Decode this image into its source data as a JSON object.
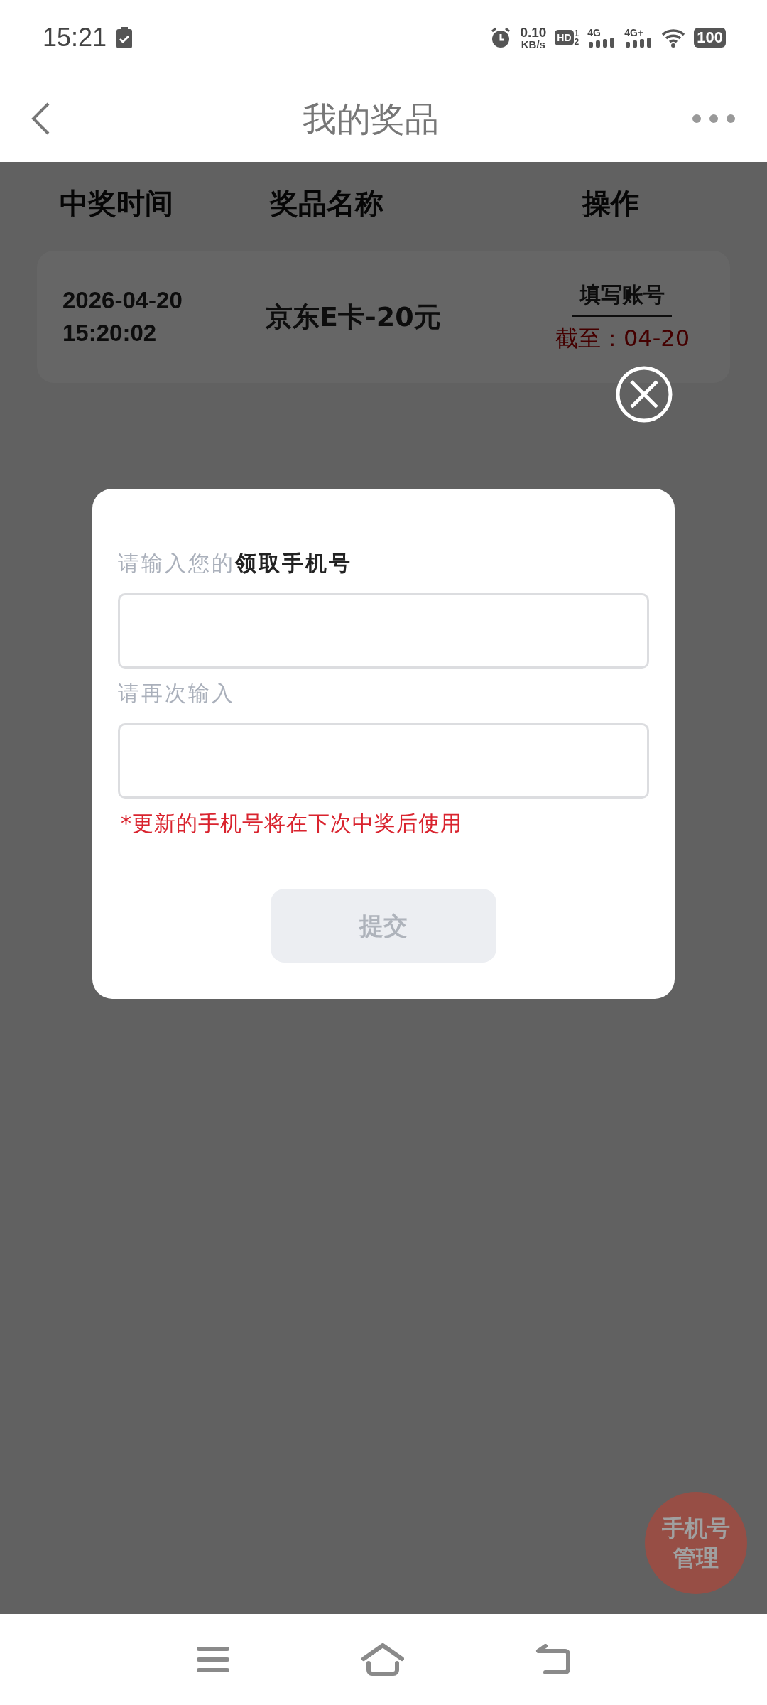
{
  "status_bar": {
    "time": "15:21",
    "speed_value": "0.10",
    "speed_unit": "KB/s",
    "hd": "HD",
    "sim_1": "1",
    "sim_2": "2",
    "network_1": "4G",
    "network_2": "4G+",
    "battery": "100"
  },
  "header": {
    "title": "我的奖品"
  },
  "table": {
    "columns": [
      "中奖时间",
      "奖品名称",
      "操作"
    ],
    "rows": [
      {
        "time_date": "2026-04-20",
        "time_clock": "15:20:02",
        "prize": "京东E卡-20元",
        "action": "填写账号",
        "deadline": "截至：04-20"
      }
    ]
  },
  "dialog": {
    "label_1": "请输入您的**领取手机号**",
    "label_2": "请再次输入",
    "note": "*更新的手机号将在下次中奖后使用",
    "submit": {
      "label": "提交",
      "disabled": true
    }
  },
  "fab": {
    "line_1": "手机号",
    "line_2": "管理"
  }
}
